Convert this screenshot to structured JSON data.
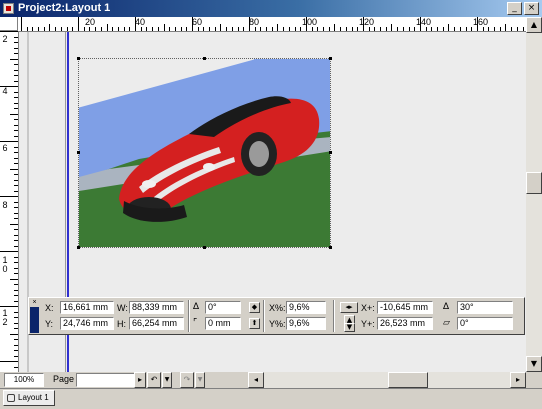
{
  "window": {
    "title": "Project2:Layout 1",
    "minimize_glyph": "_",
    "close_glyph": "×"
  },
  "rulers": {
    "horizontal_labels": [
      "20",
      "40",
      "60",
      "80",
      "100",
      "120",
      "140",
      "160"
    ],
    "vertical_labels": [
      "2",
      "4",
      "6",
      "8",
      "10",
      "12"
    ]
  },
  "measurements": {
    "x_label": "X:",
    "x_value": "16,661 mm",
    "y_label": "Y:",
    "y_value": "24,746 mm",
    "w_label": "W:",
    "w_value": "88,339 mm",
    "h_label": "H:",
    "h_value": "66,254 mm",
    "angle_value": "0°",
    "corner_value": "0 mm",
    "scale_x_label": "X%:",
    "scale_x_value": "9,6%",
    "scale_y_label": "Y%:",
    "scale_y_value": "9,6%",
    "offset_x_label": "X+:",
    "offset_x_value": "-10,645 mm",
    "offset_y_label": "Y+:",
    "offset_y_value": "26,523 mm",
    "picture_angle_value": "30°",
    "picture_skew_value": "0°"
  },
  "status": {
    "zoom": "100%",
    "page_label": "Page"
  },
  "tabs": [
    {
      "label": "Layout 1",
      "active": true
    }
  ],
  "icons": [
    "document-icon",
    "minimize-icon",
    "close-icon",
    "scroll-up-icon",
    "scroll-down-icon",
    "scroll-left-icon",
    "scroll-right-icon",
    "undo-icon",
    "redo-icon",
    "layout-tab-icon"
  ],
  "colors": {
    "title_bar": "#0a246a",
    "guide_line": "#3030d0",
    "car_body": "#d42020",
    "grass": "#3c7a34",
    "sky": "#7f9fe6"
  }
}
